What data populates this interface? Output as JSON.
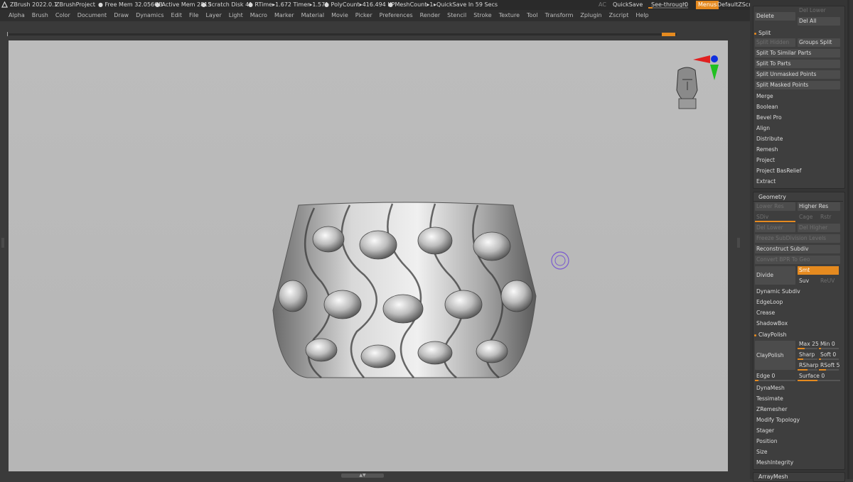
{
  "titlebar": {
    "app": "ZBrush 2022.0.1",
    "project": "ZBrushProject",
    "dot": ".",
    "free_mem": "● Free Mem 32.056GB",
    "active_mem": "● Active Mem 2813",
    "scratch": "● Scratch Disk 41",
    "rtime": "● RTime▸1.672 Timer▸1.571",
    "polycount": "● PolyCount▸416.494 KP",
    "meshcount": "● MeshCount▸1",
    "quicksave_in": "▸QuickSave In 59 Secs",
    "ac": "AC",
    "quicksave": "QuickSave",
    "see_through": "See-through",
    "see_through_value": "0",
    "see_through_level": 0.1,
    "menus": "Menus",
    "default_zscript": "DefaultZScript"
  },
  "menubar": [
    "Alpha",
    "Brush",
    "Color",
    "Document",
    "Draw",
    "Dynamics",
    "Edit",
    "File",
    "Layer",
    "Light",
    "Macro",
    "Marker",
    "Material",
    "Movie",
    "Picker",
    "Preferences",
    "Render",
    "Stencil",
    "Stroke",
    "Texture",
    "Tool",
    "Transform",
    "Zplugin",
    "Zscript",
    "Help"
  ],
  "panel": {
    "delete": "Delete",
    "del_lower": "Del Lower",
    "del_all": "Del All",
    "split_header": "Split",
    "split_hidden": "Split Hidden",
    "groups_split": "Groups Split",
    "split_similar": "Split To Similar Parts",
    "split_parts": "Split To Parts",
    "split_unmasked": "Split Unmasked Points",
    "split_masked": "Split Masked Points",
    "merge": "Merge",
    "boolean": "Boolean",
    "bevel_pro": "Bevel Pro",
    "align": "Align",
    "distribute": "Distribute",
    "remesh": "Remesh",
    "project": "Project",
    "project_basrelief": "Project BasRelief",
    "extract": "Extract",
    "geometry_header": "Geometry",
    "lower_res": "Lower Res",
    "higher_res": "Higher Res",
    "sdiv": "SDiv",
    "cage": "Cage",
    "rstr": "Rstr",
    "del_lower2": "Del Lower",
    "del_higher": "Del Higher",
    "freeze_subdiv": "Freeze SubDivision Levels",
    "reconstruct_subdiv": "Reconstruct Subdiv",
    "convert_bpr": "Convert BPR To Geo",
    "divide": "Divide",
    "smt": "Smt",
    "suv": "Suv",
    "reuv": "ReUV",
    "dynamic_subdiv": "Dynamic Subdiv",
    "edgeloop": "EdgeLoop",
    "crease": "Crease",
    "shadowbox": "ShadowBox",
    "claypolish_header": "ClayPolish",
    "claypolish": "ClayPolish",
    "max": "Max 25",
    "min": "Min 0",
    "sharp": "Sharp",
    "soft": "Soft 0",
    "rsharp": "RSharp",
    "rsoft": "RSoft 5",
    "edge": "Edge 0",
    "surface": "Surface 0",
    "dynamesh": "DynaMesh",
    "tessimate": "Tessimate",
    "zremesher": "ZRemesher",
    "modify_topology": "Modify Topology",
    "stager": "Stager",
    "position": "Position",
    "size": "Size",
    "meshintegrity": "MeshIntegrity",
    "arraymesh": "ArrayMesh"
  },
  "colors": {
    "accent": "#e58a1f",
    "canvas": "#b9b9b9",
    "gizmo_x": "#e02020",
    "gizmo_y": "#20c020",
    "gizmo_z": "#1030e0"
  },
  "icons": {
    "logo": "zbrush-logo-icon",
    "cursor": "brush-cursor-icon"
  }
}
